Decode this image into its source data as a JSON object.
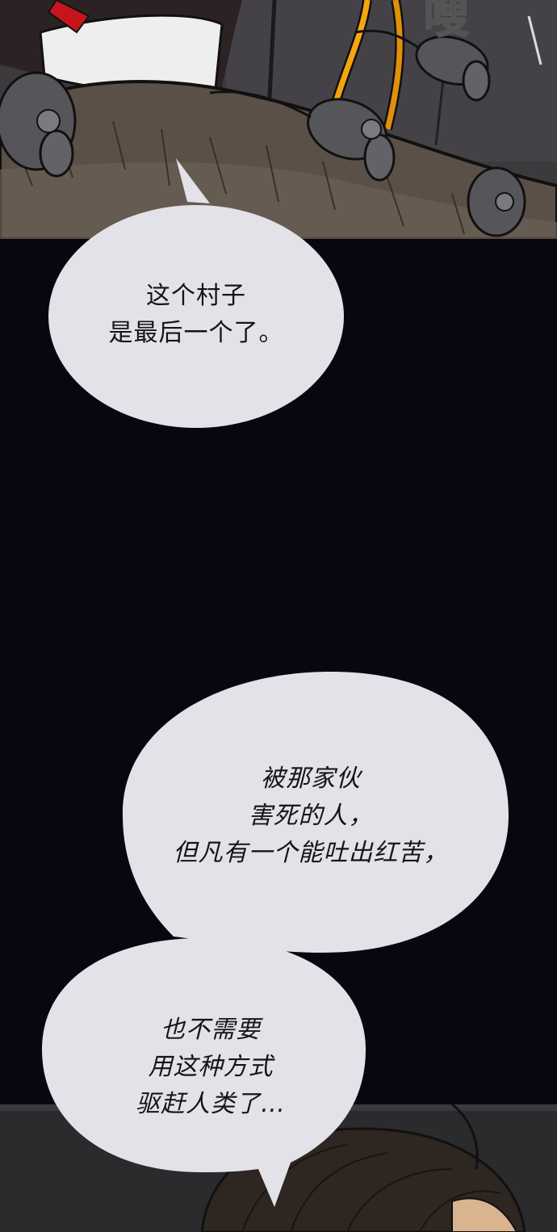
{
  "panels": {
    "top": {
      "sfx_text": "嗖",
      "colors": {
        "ledge": "#5a5047",
        "wall": "#3e3c3f",
        "rat": "#55555a",
        "rope": "#f5a50e",
        "outline": "#111111"
      }
    },
    "bottom": {
      "colors": {
        "hair": "#2e2620",
        "skin": "#d9b48f",
        "wall": "#2b2b2e"
      }
    }
  },
  "bubbles": [
    {
      "id": "speech-1",
      "lines": [
        "这个村子",
        "是最后一个了。"
      ],
      "fill": "#e2e2e8"
    },
    {
      "id": "speech-2",
      "lines": [
        "被那家伙",
        "害死的人，",
        "但凡有一个能吐出红苦，"
      ],
      "fill": "#e2e2e8"
    },
    {
      "id": "speech-3",
      "lines": [
        "也不需要",
        "用这种方式",
        "驱赶人类了…"
      ],
      "fill": "#e2e2e8"
    }
  ],
  "background": "#06070f"
}
